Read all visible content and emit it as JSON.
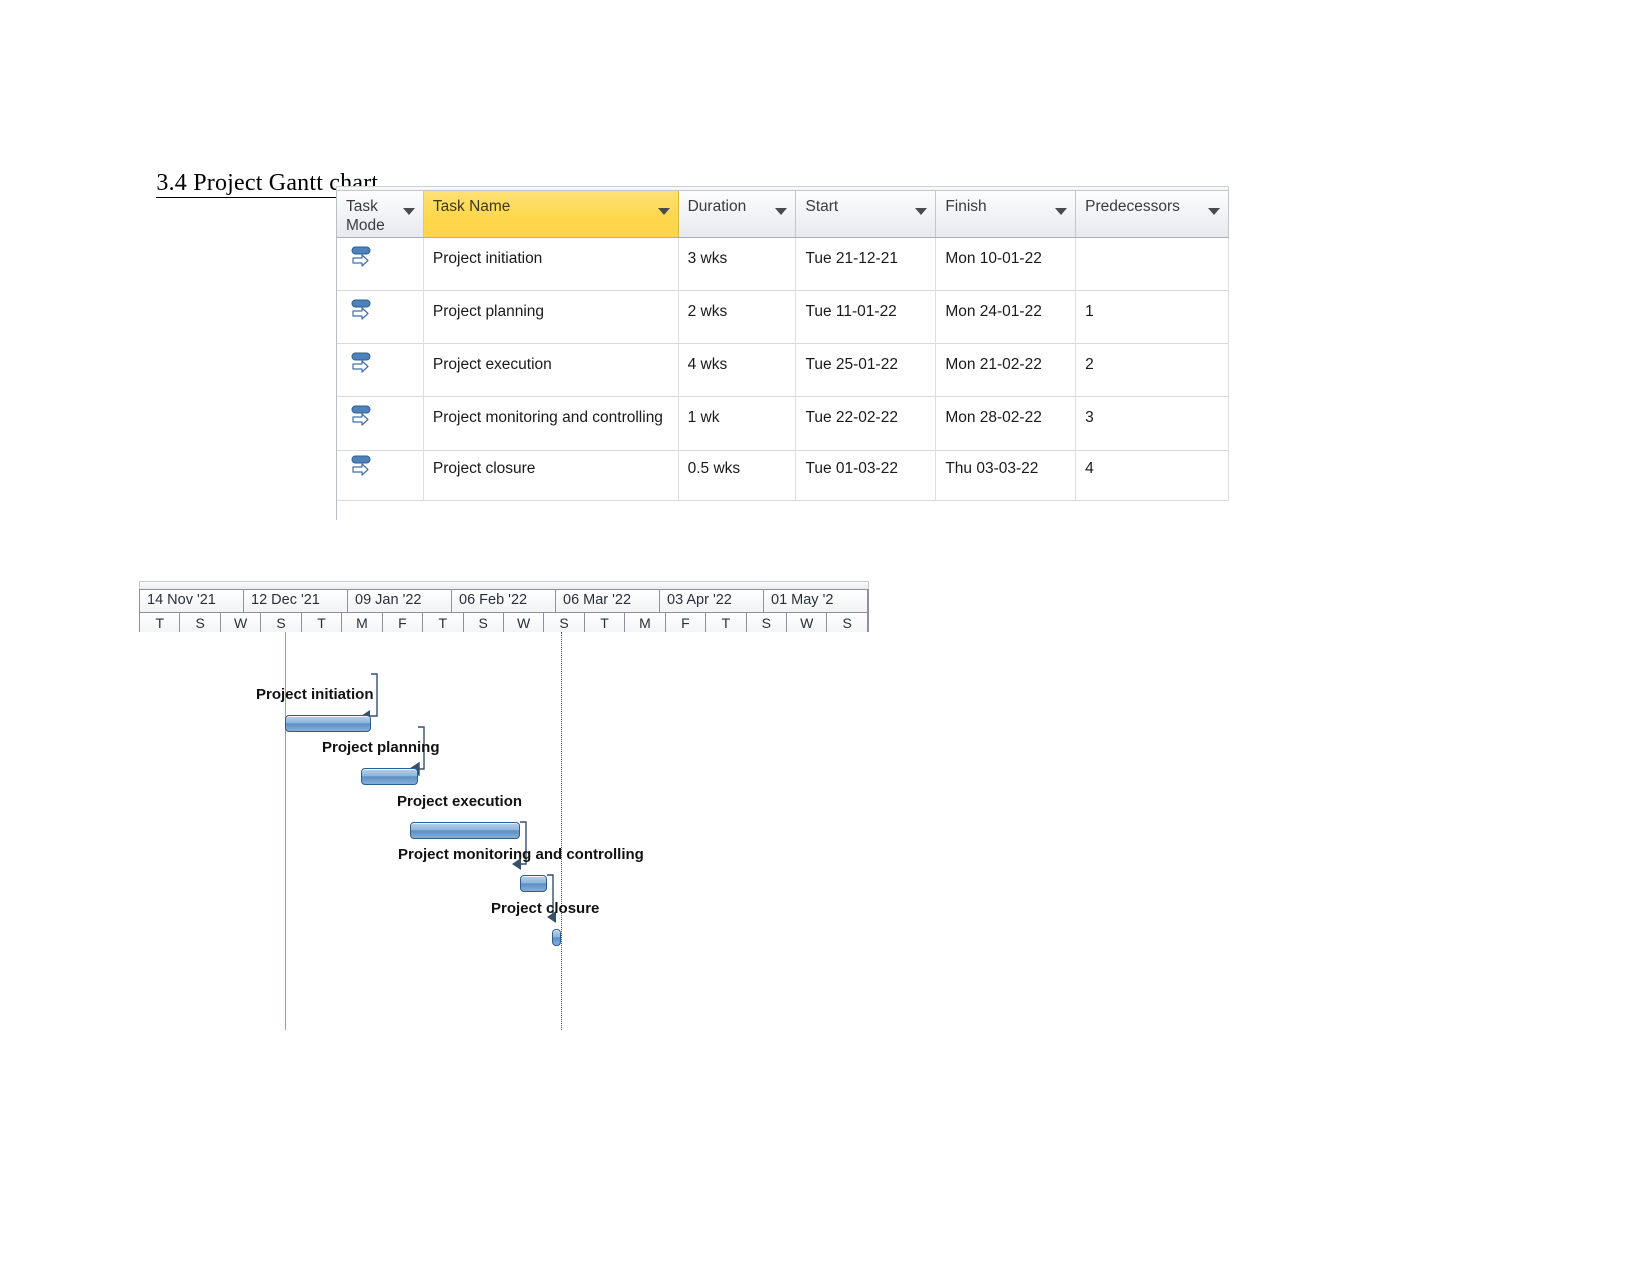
{
  "heading": {
    "text": "3.4 Project Gantt chart "
  },
  "colors": {
    "selected_column": "#ffd84d",
    "bar_fill": "#5e90c4",
    "bar_border": "#2e5f8a",
    "project_start_line": "#e8922a",
    "status_line": "#555555"
  },
  "task_table": {
    "columns": [
      {
        "key": "task_mode",
        "label": "Task\nMode",
        "selected": false,
        "has_filter_arrow": true
      },
      {
        "key": "task_name",
        "label": "Task Name",
        "selected": true,
        "has_filter_arrow": true
      },
      {
        "key": "duration",
        "label": "Duration",
        "selected": false,
        "has_filter_arrow": true
      },
      {
        "key": "start",
        "label": "Start",
        "selected": false,
        "has_filter_arrow": true
      },
      {
        "key": "finish",
        "label": "Finish",
        "selected": false,
        "has_filter_arrow": true
      },
      {
        "key": "predecessors",
        "label": "Predecessors",
        "selected": false,
        "has_filter_arrow": true
      }
    ],
    "column_labels": {
      "task_mode_line1": "Task",
      "task_mode_line2": "Mode",
      "task_name": "Task Name",
      "duration": "Duration",
      "start": "Start",
      "finish": "Finish",
      "predecessors": "Predecessors"
    },
    "rows": [
      {
        "mode_icon": "auto-scheduled-icon",
        "name": "Project initiation",
        "duration": "3 wks",
        "start": "Tue 21-12-21",
        "finish": "Mon 10-01-22",
        "predecessors": ""
      },
      {
        "mode_icon": "auto-scheduled-icon",
        "name": "Project planning",
        "duration": "2 wks",
        "start": "Tue 11-01-22",
        "finish": "Mon 24-01-22",
        "predecessors": "1"
      },
      {
        "mode_icon": "auto-scheduled-icon",
        "name": "Project execution",
        "duration": "4 wks",
        "start": "Tue 25-01-22",
        "finish": "Mon 21-02-22",
        "predecessors": "2"
      },
      {
        "mode_icon": "auto-scheduled-icon",
        "name": "Project monitoring and controlling",
        "duration": "1 wk",
        "start": "Tue 22-02-22",
        "finish": "Mon 28-02-22",
        "predecessors": "3"
      },
      {
        "mode_icon": "auto-scheduled-icon",
        "name": "Project closure",
        "duration": "0.5 wks",
        "start": "Tue 01-03-22",
        "finish": "Thu 03-03-22",
        "predecessors": "4"
      }
    ]
  },
  "chart_data": {
    "type": "bar",
    "title": "Project Gantt chart",
    "orientation": "horizontal-timeline",
    "timescale_major": [
      "14 Nov '21",
      "12 Dec '21",
      "09 Jan '22",
      "06 Feb '22",
      "06 Mar '22",
      "03 Apr '22",
      "01 May '2"
    ],
    "timescale_minor": [
      "T",
      "S",
      "W",
      "S",
      "T",
      "M",
      "F",
      "T",
      "S",
      "W",
      "S",
      "T",
      "M",
      "F",
      "T",
      "S",
      "W",
      "S"
    ],
    "xlabel": "",
    "ylabel": "",
    "grid": false,
    "legend": "none",
    "markers": [
      {
        "name": "project-start-line",
        "label": "",
        "color": "#e8922a",
        "style": "solid"
      },
      {
        "name": "status-date-line",
        "label": "",
        "color": "#555555",
        "style": "dotted"
      }
    ],
    "categories": [
      "Project initiation",
      "Project planning",
      "Project execution",
      "Project monitoring and controlling",
      "Project closure"
    ],
    "bars": [
      {
        "label": "Project initiation",
        "start": "Tue 21-12-21",
        "finish": "Mon 10-01-22",
        "duration": "3 wks",
        "predecessors": ""
      },
      {
        "label": "Project planning",
        "start": "Tue 11-01-22",
        "finish": "Mon 24-01-22",
        "duration": "2 wks",
        "predecessors": "1"
      },
      {
        "label": "Project execution",
        "start": "Tue 25-01-22",
        "finish": "Mon 21-02-22",
        "duration": "4 wks",
        "predecessors": "2"
      },
      {
        "label": "Project monitoring and controlling",
        "start": "Tue 22-02-22",
        "finish": "Mon 28-02-22",
        "duration": "1 wk",
        "predecessors": "3"
      },
      {
        "label": "Project closure",
        "start": "Tue 01-03-22",
        "finish": "Thu 03-03-22",
        "duration": "0.5 wks",
        "predecessors": "4"
      }
    ],
    "values": [
      3,
      2,
      4,
      1,
      0.5
    ],
    "value_unit": "weeks"
  }
}
